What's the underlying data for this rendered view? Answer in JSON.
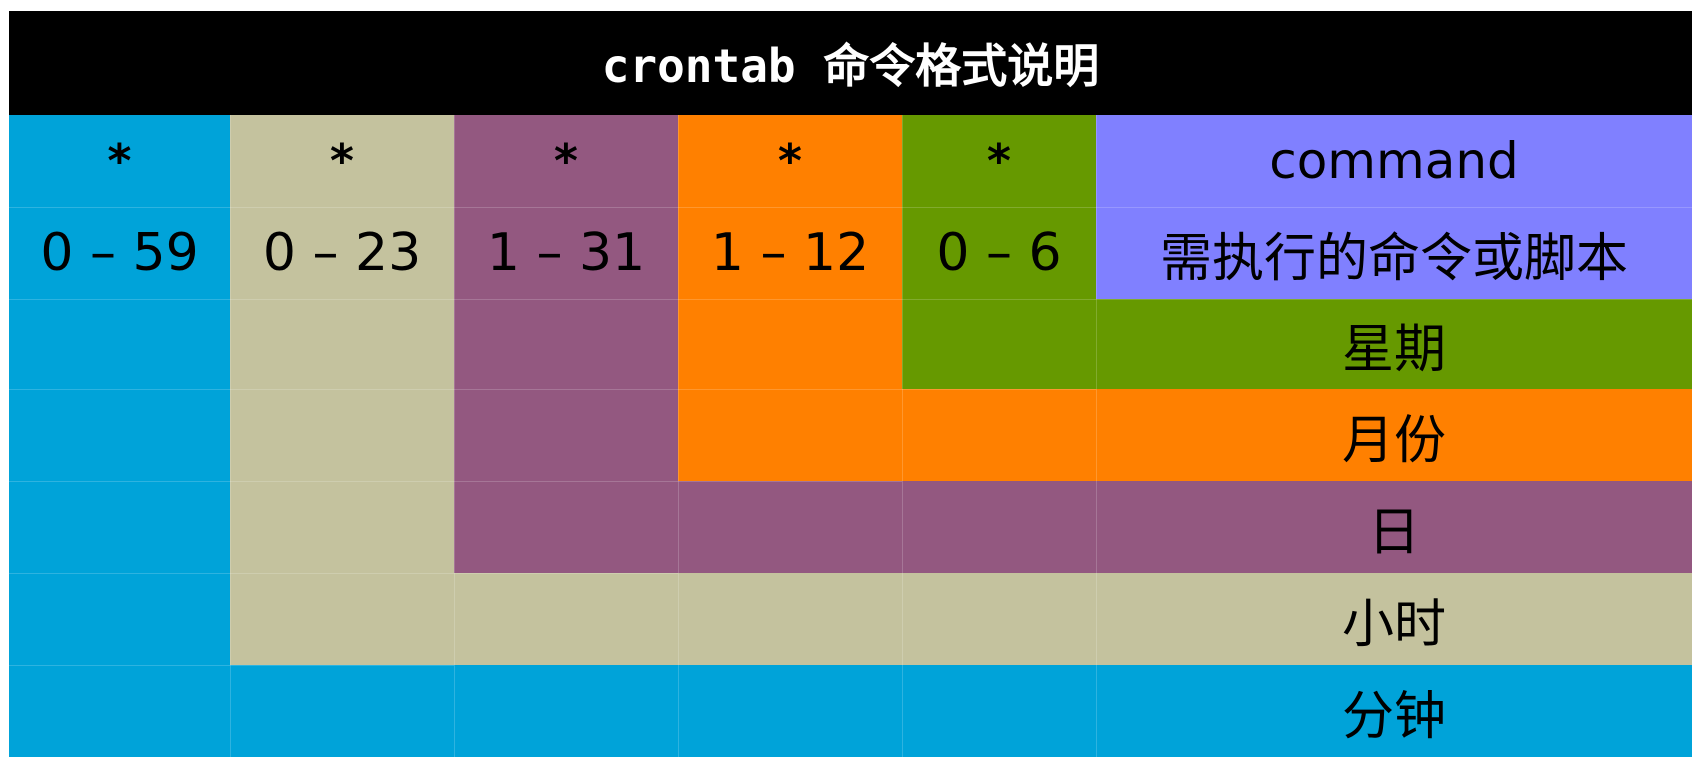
{
  "title": "crontab 命令格式说明",
  "colors": {
    "minute": "#00A3D9",
    "hour": "#C4C29E",
    "day": "#935880",
    "month": "#FF8000",
    "weekday": "#669900",
    "command": "#8080FF",
    "title_bg": "#000000"
  },
  "columns": [
    {
      "key": "minute",
      "symbol": "*",
      "range": "0 – 59"
    },
    {
      "key": "hour",
      "symbol": "*",
      "range": "0 – 23"
    },
    {
      "key": "day",
      "symbol": "*",
      "range": "1 – 31"
    },
    {
      "key": "month",
      "symbol": "*",
      "range": "1 – 12"
    },
    {
      "key": "weekday",
      "symbol": "*",
      "range": "0 – 6"
    }
  ],
  "command": {
    "label": "command",
    "description": "需执行的命令或脚本"
  },
  "field_labels": [
    {
      "key": "weekday",
      "label": "星期"
    },
    {
      "key": "month",
      "label": "月份"
    },
    {
      "key": "day",
      "label": "日"
    },
    {
      "key": "hour",
      "label": "小时"
    },
    {
      "key": "minute",
      "label": "分钟"
    }
  ]
}
